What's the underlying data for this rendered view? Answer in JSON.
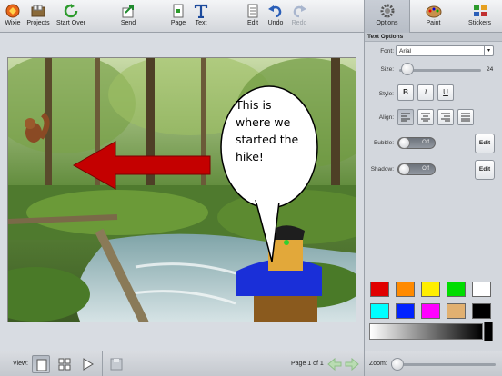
{
  "toolbar": {
    "wixie": "Wixie",
    "projects": "Projects",
    "start_over": "Start Over",
    "send": "Send",
    "page": "Page",
    "text": "Text",
    "edit": "Edit",
    "undo": "Undo",
    "redo": "Redo"
  },
  "right_tabs": {
    "options": "Options",
    "paint": "Paint",
    "stickers": "Stickers"
  },
  "scene": {
    "bubble_text": "This is where we started the hike!"
  },
  "panel": {
    "heading": "Text Options",
    "font_label": "Font:",
    "font_value": "Arial",
    "size_label": "Size:",
    "size_value": "24",
    "style_label": "Style:",
    "bold": "B",
    "italic": "I",
    "underline": "U",
    "align_label": "Align:",
    "bubble_label": "Bubble:",
    "shadow_label": "Shadow:",
    "toggle_off": "Off",
    "edit_label": "Edit",
    "swatches": [
      "#e00000",
      "#ff8a00",
      "#ffee00",
      "#00dd00",
      "#ffffff",
      "#00ffff",
      "#0022ff",
      "#ff00ff",
      "#e1b070",
      "#000000"
    ]
  },
  "bottom": {
    "view_label": "View:",
    "page_indicator": "Page 1 of 1",
    "zoom_label": "Zoom:"
  },
  "colors": {
    "arrow": "#c40000",
    "shirt": "#1a2fd8",
    "accent": "#1f7a2e"
  }
}
